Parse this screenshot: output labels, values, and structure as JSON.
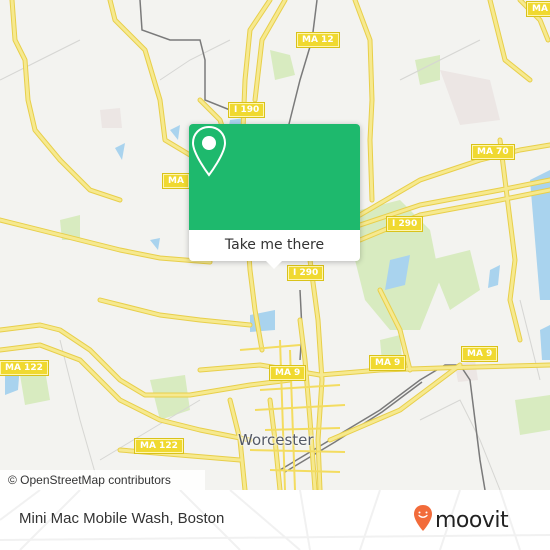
{
  "map": {
    "city_label": "Worcester",
    "attribution": "© OpenStreetMap contributors",
    "shields": [
      {
        "id": "ma12",
        "label": "MA 12"
      },
      {
        "id": "i190",
        "label": "I 190"
      },
      {
        "id": "ma-left",
        "label": "MA"
      },
      {
        "id": "ma70",
        "label": "MA 70"
      },
      {
        "id": "i290-east",
        "label": "I 290"
      },
      {
        "id": "i290-center",
        "label": "I 290"
      },
      {
        "id": "ma9-west",
        "label": "MA 9"
      },
      {
        "id": "ma9-center",
        "label": "MA 9"
      },
      {
        "id": "ma9-east",
        "label": "MA 9"
      },
      {
        "id": "ma122-west",
        "label": "MA 122"
      },
      {
        "id": "ma122-center",
        "label": "MA 122"
      },
      {
        "id": "ma-topright",
        "label": "MA"
      }
    ],
    "colors": {
      "background": "#f3f3f0",
      "road": "#f5e27a",
      "road_casing": "#e8cf4a",
      "water": "#a9d3ee",
      "park": "#d8ebc0",
      "rail": "#7a7a7a"
    }
  },
  "popup": {
    "icon": "location-pin-icon",
    "action_label": "Take me there",
    "color": "#1eb96d"
  },
  "footer": {
    "place_name": "Mini Mac Mobile Wash, Boston",
    "brand": "moovit",
    "brand_color": "#f26b3a"
  }
}
